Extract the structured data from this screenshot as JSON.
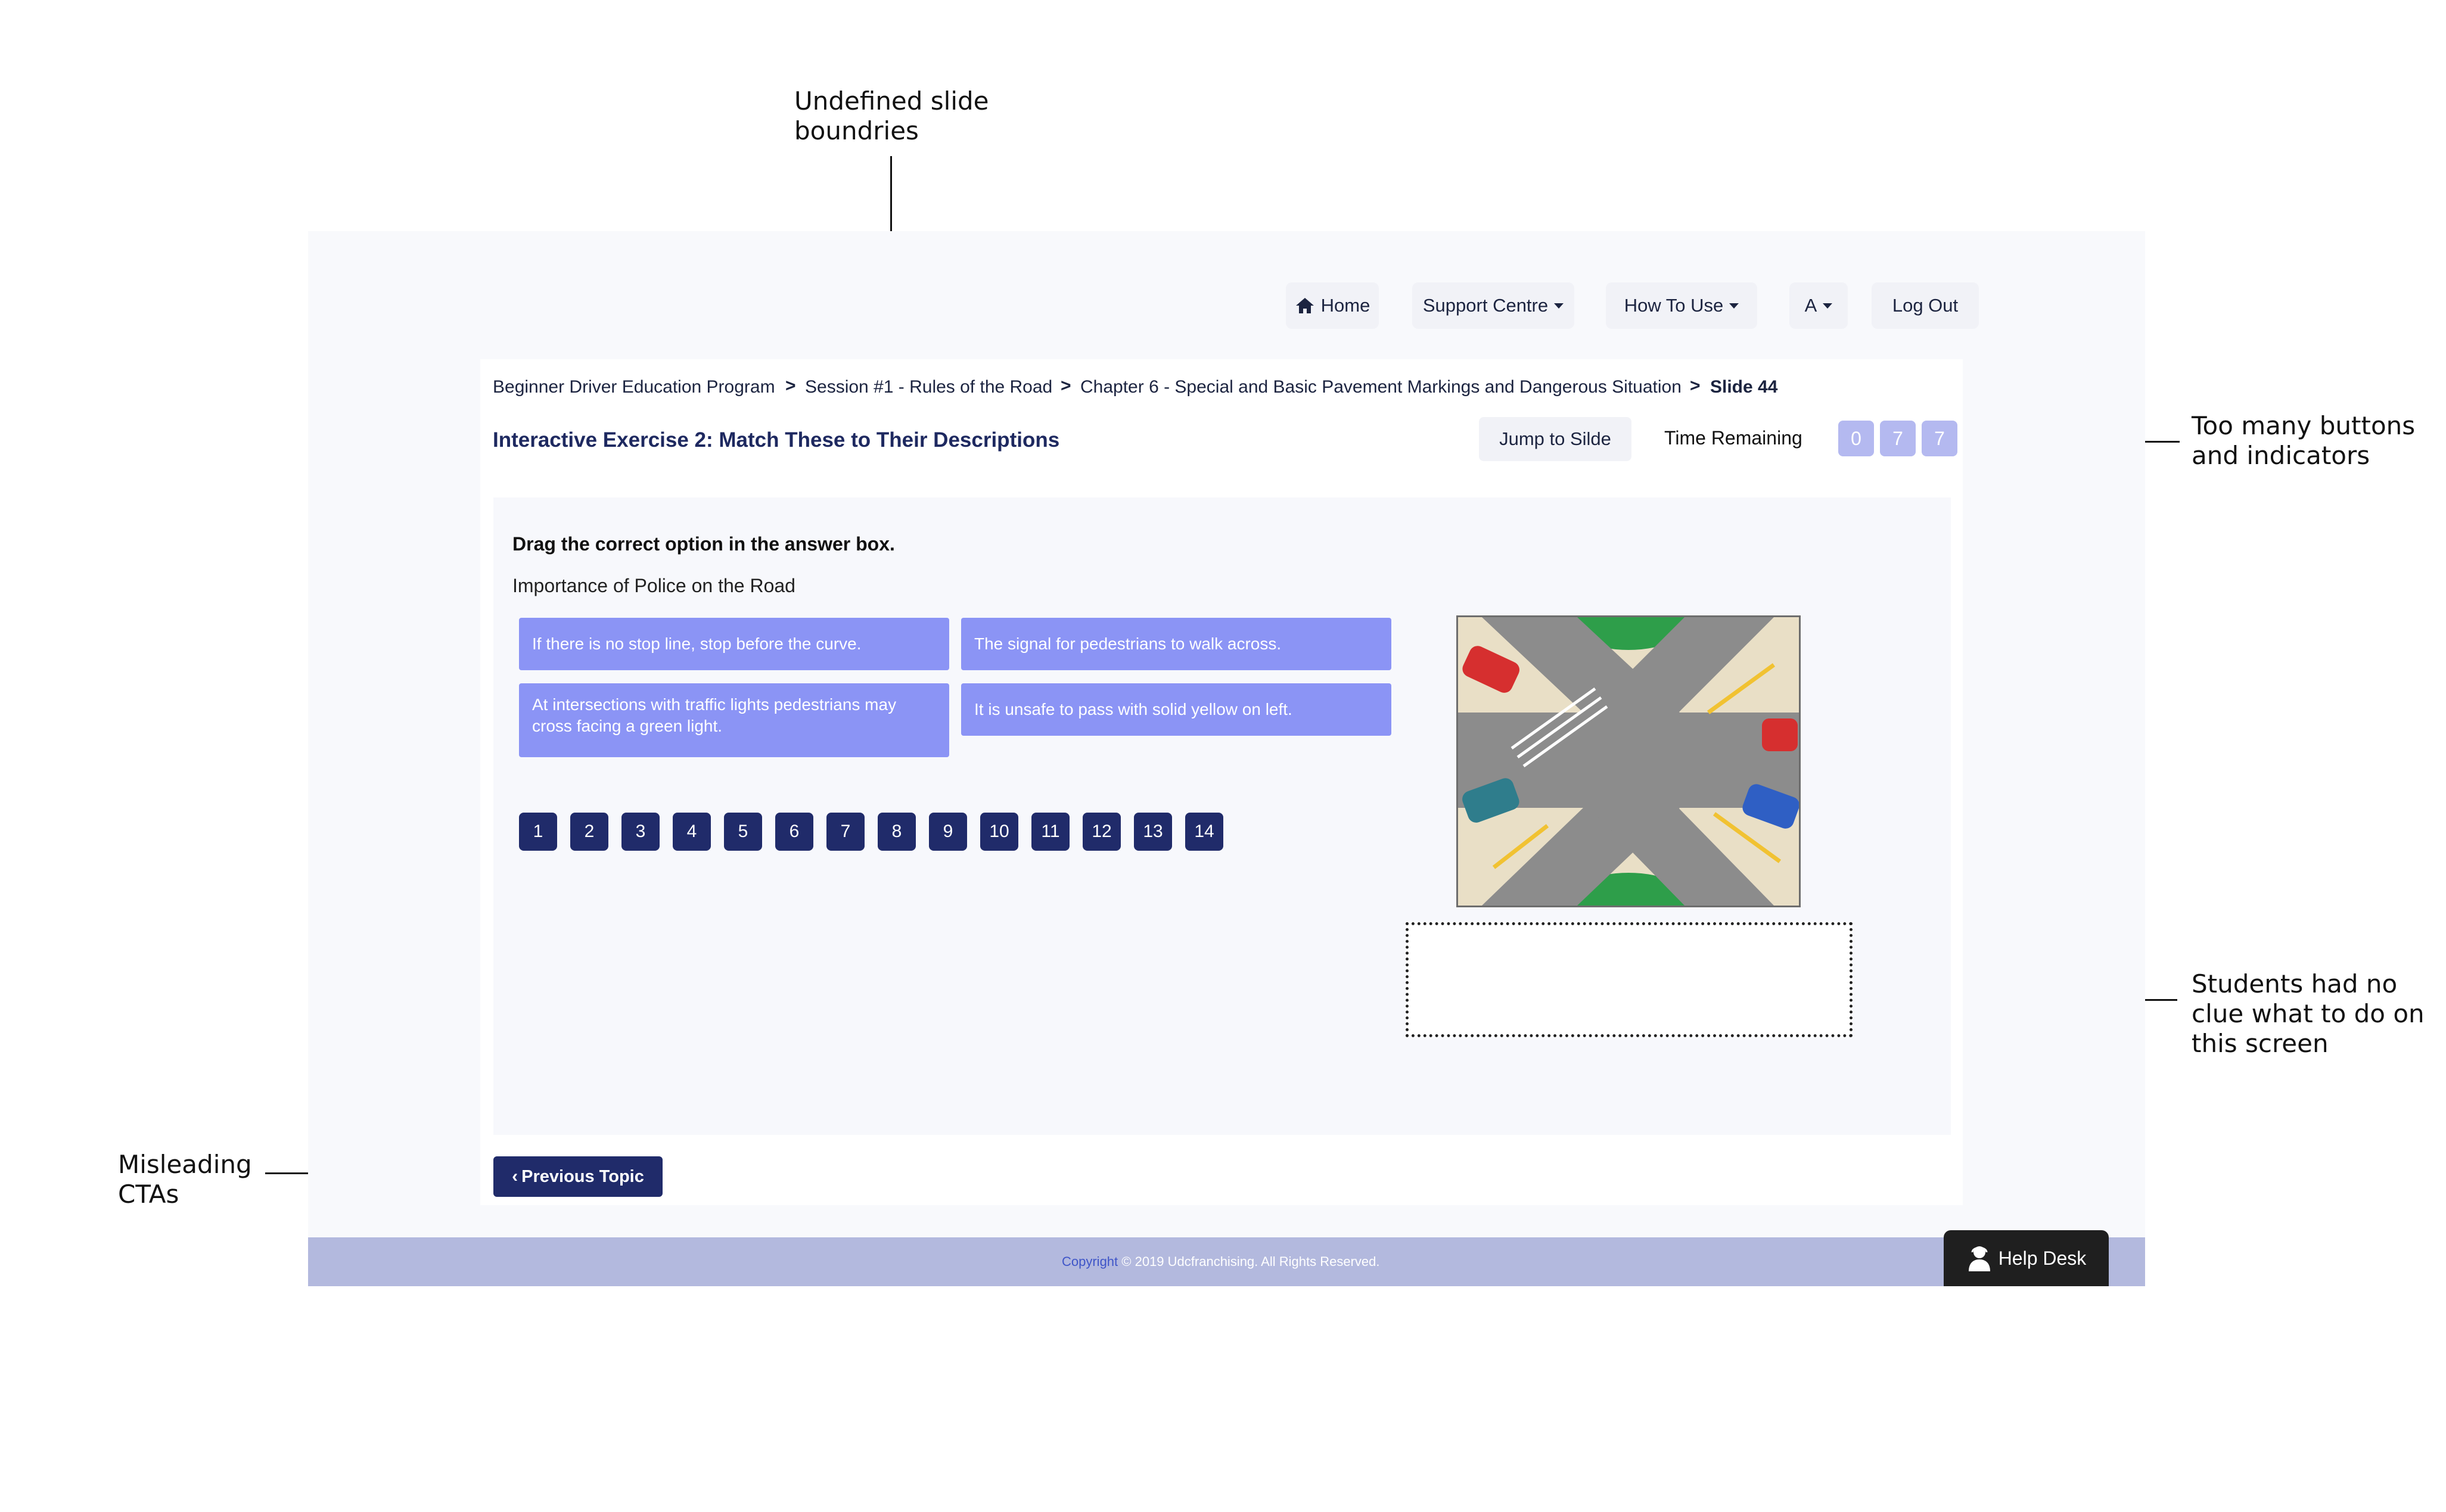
{
  "annotations": {
    "slide_boundaries": [
      "Undefined slide",
      "boundries"
    ],
    "too_many_buttons": [
      "Too many buttons",
      "and indicators"
    ],
    "students_no_clue": [
      "Students had no",
      "clue what to do on",
      "this screen"
    ],
    "misleading_ctas": [
      "Misleading",
      "CTAs"
    ]
  },
  "nav": {
    "home": "Home",
    "support": "Support Centre",
    "how_to_use": "How To Use",
    "font_size": "A",
    "logout": "Log Out"
  },
  "breadcrumb": {
    "items": [
      "Beginner Driver Education Program",
      "Session #1 - Rules of the Road",
      "Chapter 6 - Special and Basic Pavement Markings and Dangerous Situation",
      "Slide 44"
    ],
    "separator": ">"
  },
  "exercise": {
    "title": "Interactive Exercise 2: Match These to Their Descriptions",
    "jump_label": "Jump to Silde",
    "time_label": "Time Remaining",
    "timer_digits": [
      "0",
      "7",
      "7"
    ],
    "instruction": "Drag the correct option in the answer box.",
    "question": "Importance of Police on the Road",
    "options": [
      "If there is no stop line, stop before the curve.",
      "The signal for pedestrians to walk across.",
      "At intersections with traffic lights pedestrians may cross facing a green light.",
      "It is unsafe to pass with solid yellow on left."
    ],
    "slide_numbers": [
      "1",
      "2",
      "3",
      "4",
      "5",
      "6",
      "7",
      "8",
      "9",
      "10",
      "11",
      "12",
      "13",
      "14"
    ],
    "prev_button": "Previous Topic"
  },
  "footer": {
    "copyright_link": "Copyright",
    "copyright_rest": "© 2019 Udcfranchising. All Rights Reserved.",
    "help_desk": "Help Desk"
  },
  "colors": {
    "accent": "#202b6a",
    "option_bg": "#8b94f5",
    "timer_bg": "#b4b9f0",
    "footer_bg": "#b3b9de"
  }
}
